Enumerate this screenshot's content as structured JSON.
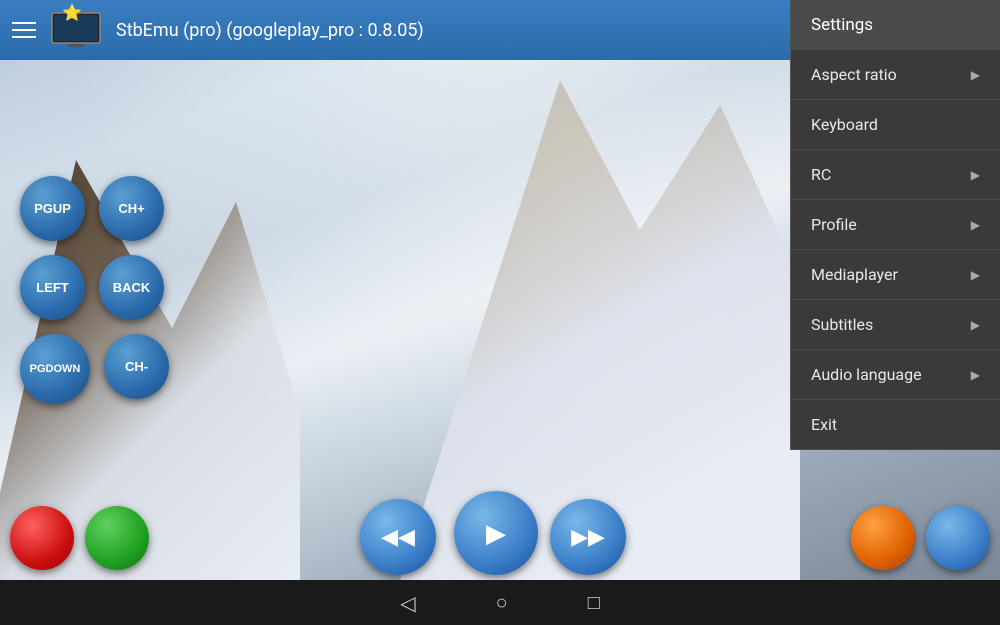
{
  "header": {
    "title": "StbEmu (pro) (googleplay_pro : 0.8.05)",
    "star": "⭐"
  },
  "menu": {
    "items": [
      {
        "id": "settings",
        "label": "Settings",
        "has_arrow": false,
        "active": true
      },
      {
        "id": "aspect-ratio",
        "label": "Aspect ratio",
        "has_arrow": true
      },
      {
        "id": "keyboard",
        "label": "Keyboard",
        "has_arrow": false
      },
      {
        "id": "rc",
        "label": "RC",
        "has_arrow": true
      },
      {
        "id": "profile",
        "label": "Profile",
        "has_arrow": true
      },
      {
        "id": "mediaplayer",
        "label": "Mediaplayer",
        "has_arrow": true
      },
      {
        "id": "subtitles",
        "label": "Subtitles",
        "has_arrow": true
      },
      {
        "id": "audio-language",
        "label": "Audio language",
        "has_arrow": true
      },
      {
        "id": "exit",
        "label": "Exit",
        "has_arrow": false
      }
    ]
  },
  "controls": {
    "buttons": [
      {
        "id": "pgup",
        "label": "PGUP"
      },
      {
        "id": "ch-plus",
        "label": "CH+"
      },
      {
        "id": "left",
        "label": "LEFT"
      },
      {
        "id": "back",
        "label": "BACK"
      },
      {
        "id": "pgdown",
        "label": "PGDOWN"
      },
      {
        "id": "ch-minus",
        "label": "CH-"
      }
    ]
  },
  "navbar": {
    "back_icon": "◁",
    "home_icon": "○",
    "recents_icon": "□"
  },
  "media": {
    "rewind_icon": "◀◀",
    "play_icon": "▶",
    "forward_icon": "▶▶"
  }
}
